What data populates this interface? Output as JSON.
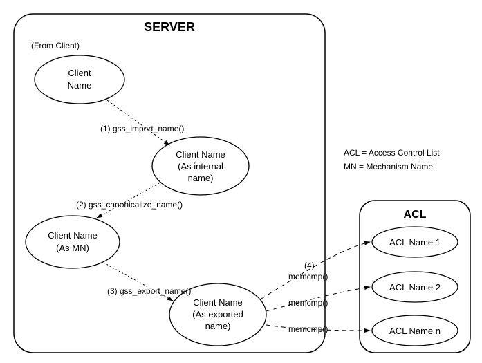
{
  "server": {
    "title": "SERVER",
    "from_client": "(From Client)",
    "nodes": {
      "client_name": {
        "line1": "Client",
        "line2": "Name"
      },
      "internal_name": {
        "line1": "Client Name",
        "line2": "(As internal",
        "line3": "name)"
      },
      "mn_name": {
        "line1": "Client Name",
        "line2": "(As MN)"
      },
      "exported_name": {
        "line1": "Client Name",
        "line2": "(As exported",
        "line3": "name)"
      }
    },
    "steps": {
      "s1": "(1) gss_import_name()",
      "s2": "(2) gss_canonicalize_name()",
      "s3": "(3) gss_export_name()"
    },
    "memcmp": {
      "top_number": "(4)",
      "label": "memcmp()"
    }
  },
  "acl": {
    "title": "ACL",
    "items": [
      "ACL Name 1",
      "ACL Name 2",
      "ACL Name n"
    ]
  },
  "legend": {
    "acl": "ACL = Access Control List",
    "mn": "MN = Mechanism Name"
  }
}
